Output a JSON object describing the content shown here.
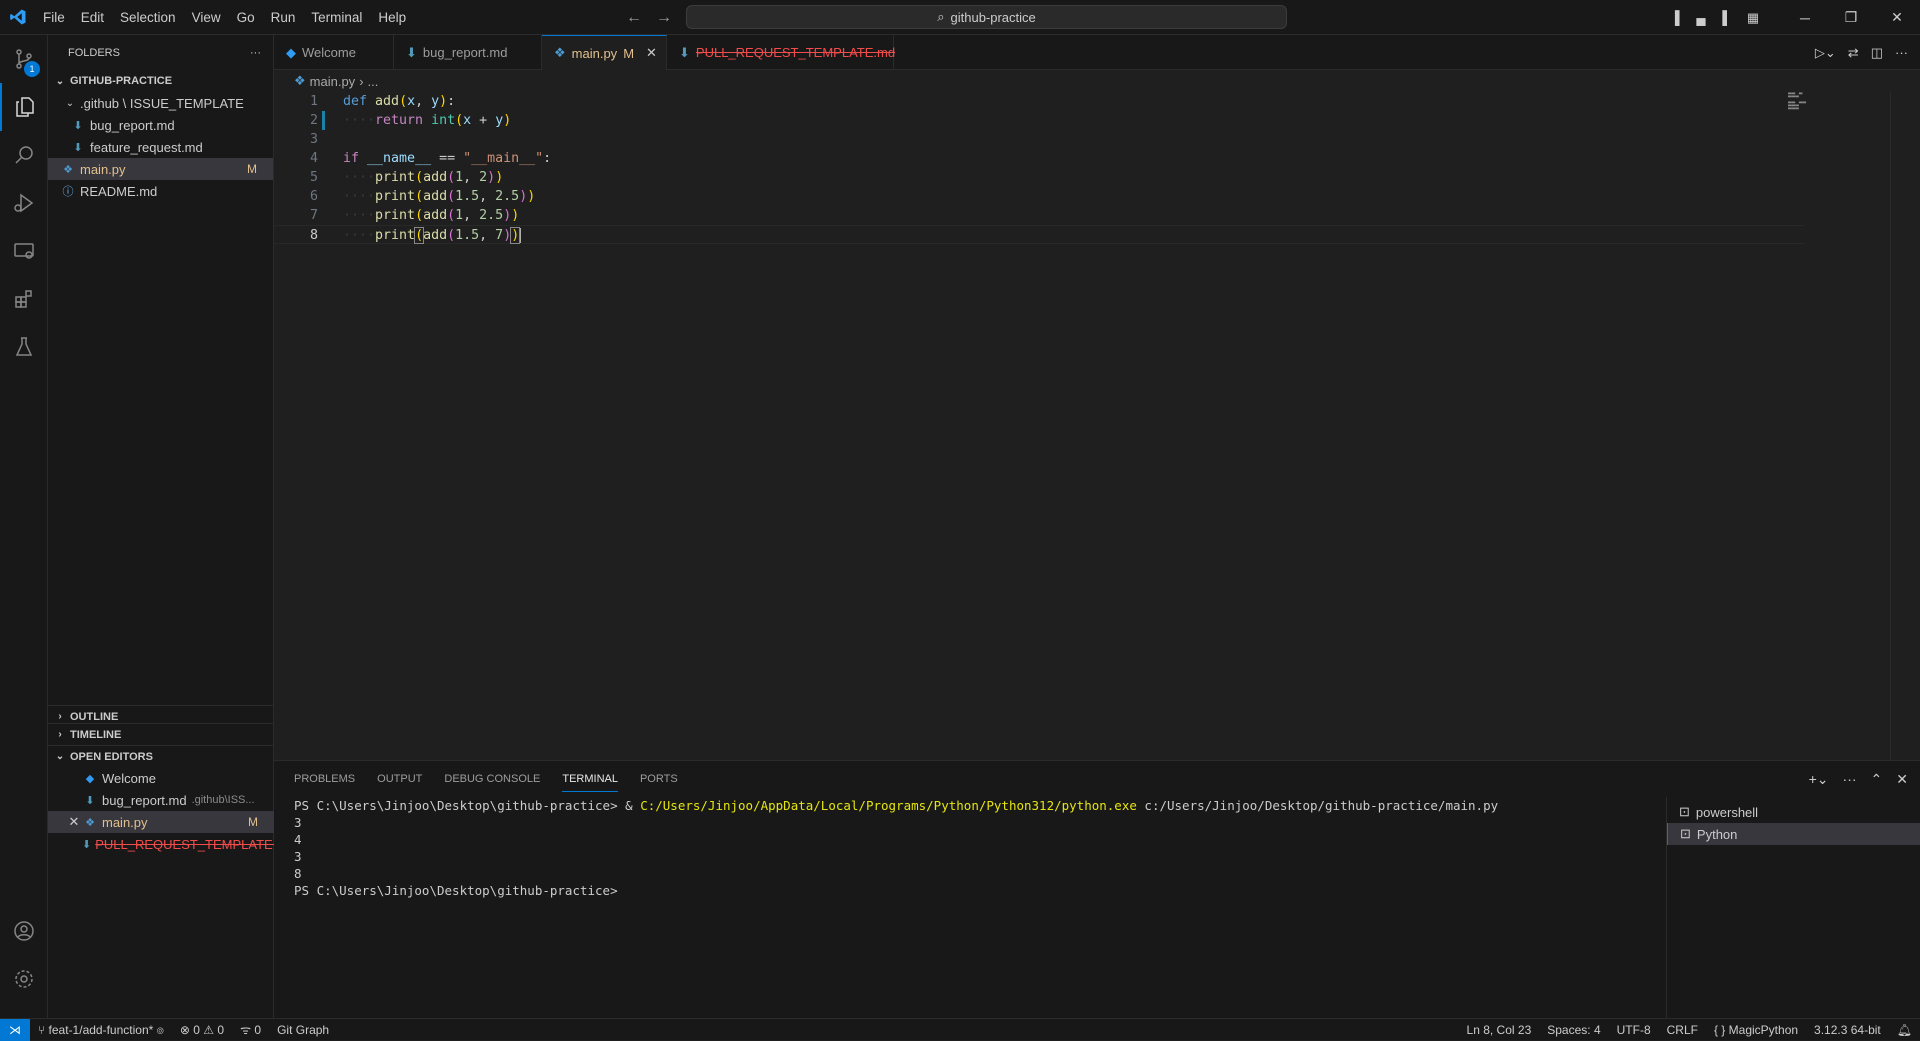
{
  "menu": [
    "File",
    "Edit",
    "Selection",
    "View",
    "Go",
    "Run",
    "Terminal",
    "Help"
  ],
  "command_center": "github-practice",
  "activity": {
    "scm_badge": "1"
  },
  "sidebar": {
    "header": "FOLDERS",
    "root": "GITHUB-PRACTICE",
    "folder": ".github \\ ISSUE_TEMPLATE",
    "files": [
      {
        "name": "bug_report.md"
      },
      {
        "name": "feature_request.md"
      }
    ],
    "main_file": "main.py",
    "main_mark": "M",
    "readme": "README.md",
    "outline": "OUTLINE",
    "timeline": "TIMELINE",
    "open_editors": "OPEN EDITORS",
    "oe_items": [
      {
        "name": "Welcome",
        "hint": ""
      },
      {
        "name": "bug_report.md",
        "hint": ".github\\ISS..."
      },
      {
        "name": "main.py",
        "hint": "M"
      },
      {
        "name": "PULL_REQUEST_TEMPLATE...",
        "hint": ""
      }
    ]
  },
  "tabs": [
    {
      "label": "Welcome"
    },
    {
      "label": "bug_report.md"
    },
    {
      "label": "main.py",
      "mark": "M"
    },
    {
      "label": "PULL_REQUEST_TEMPLATE.md"
    }
  ],
  "breadcrumb": {
    "file": "main.py",
    "rest": "..."
  },
  "code_lines": [
    "1",
    "2",
    "3",
    "4",
    "5",
    "6",
    "7",
    "8"
  ],
  "panel": {
    "tabs": [
      "PROBLEMS",
      "OUTPUT",
      "DEBUG CONSOLE",
      "TERMINAL",
      "PORTS"
    ],
    "prompt1": "PS C:\\Users\\Jinjoo\\Desktop\\github-practice> & ",
    "exe": "C:/Users/Jinjoo/AppData/Local/Programs/Python/Python312/python.exe",
    "arg": " c:/Users/Jinjoo/Desktop/github-practice/main.py",
    "outputs": [
      "3",
      "4",
      "3",
      "8"
    ],
    "prompt2": "PS C:\\Users\\Jinjoo\\Desktop\\github-practice>",
    "terminals": [
      "powershell",
      "Python"
    ]
  },
  "status": {
    "branch": "feat-1/add-function*",
    "errors": "0",
    "warnings": "0",
    "ports": "0",
    "git_graph": "Git Graph",
    "position": "Ln 8, Col 23",
    "spaces": "Spaces: 4",
    "encoding": "UTF-8",
    "eol": "CRLF",
    "language": "MagicPython",
    "interpreter": "3.12.3 64-bit"
  }
}
